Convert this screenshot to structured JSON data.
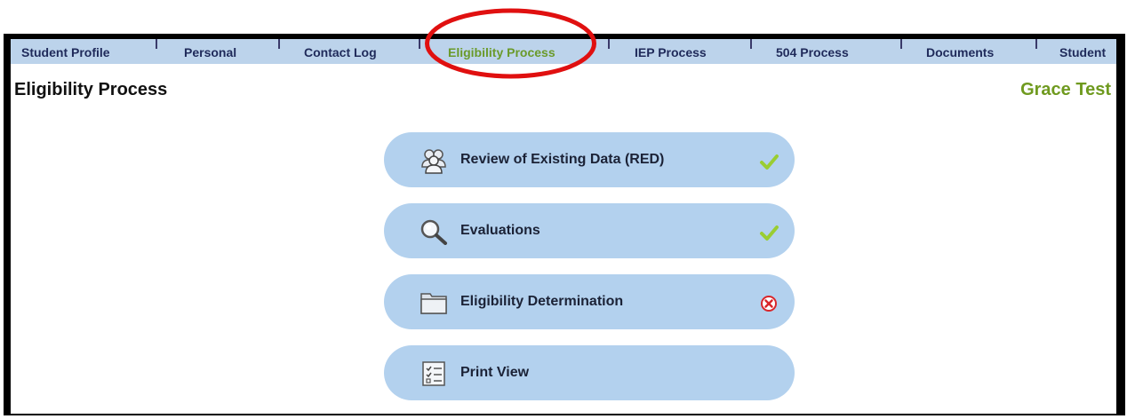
{
  "tabs": [
    {
      "label": "Student Profile"
    },
    {
      "label": "Personal"
    },
    {
      "label": "Contact Log"
    },
    {
      "label": "Eligibility Process"
    },
    {
      "label": "IEP Process"
    },
    {
      "label": "504 Process"
    },
    {
      "label": "Documents"
    },
    {
      "label": "Student"
    }
  ],
  "active_tab": "Eligibility Process",
  "header": {
    "title": "Eligibility Process",
    "student_name": "Grace Test"
  },
  "steps": [
    {
      "label": "Review of Existing Data (RED)",
      "icon": "people-icon",
      "status": "complete"
    },
    {
      "label": "Evaluations",
      "icon": "magnifier-icon",
      "status": "complete"
    },
    {
      "label": "Eligibility Determination",
      "icon": "folder-icon",
      "status": "incomplete"
    },
    {
      "label": "Print View",
      "icon": "checklist-icon",
      "status": null
    }
  ],
  "colors": {
    "tab_bar": "#bcd3eb",
    "tab_text": "#1f2a5a",
    "active_tab_text": "#6a9a2a",
    "button_fill": "#b3d1ee",
    "highlight_circle": "#e01010",
    "check_green": "#9acd32",
    "error_red": "#d9262b"
  }
}
